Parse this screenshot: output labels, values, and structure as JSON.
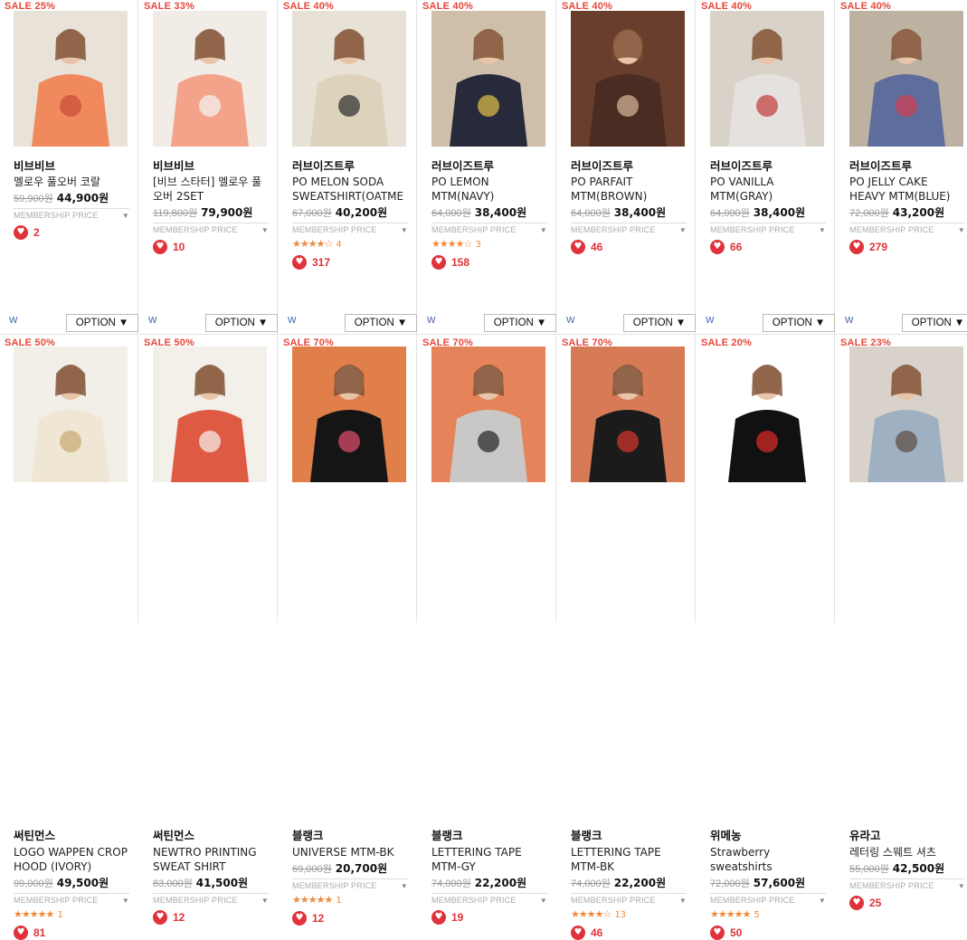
{
  "option_label": "OPTION",
  "option_arrow": "▼",
  "w_label": "W",
  "membership_label": "MEMBERSHIP PRICE",
  "heart_icon": "heart-icon",
  "colors": {
    "accent": "#e5483b",
    "heart": "#e0323a",
    "star": "#f08a3c"
  },
  "products": [
    {
      "badge": "SALE 25%",
      "brand": "비브비브",
      "name": "멜로우 풀오버 코랄",
      "orig": "59,900원",
      "sale": "44,900원",
      "rating": null,
      "review_count": null,
      "likes": "2"
    },
    {
      "badge": "SALE 33%",
      "brand": "비브비브",
      "name": "[비브 스타터] 멜로우 풀오버 2SET",
      "orig": "119,800원",
      "sale": "79,900원",
      "rating": null,
      "review_count": null,
      "likes": "10"
    },
    {
      "badge": "SALE 40%",
      "brand": "러브이즈트루",
      "name": "PO MELON SODA SWEATSHIRT(OATME",
      "orig": "67,000원",
      "sale": "40,200원",
      "rating": 4,
      "stars_text": "★★★★☆",
      "review_count": "4",
      "likes": "317"
    },
    {
      "badge": "SALE 40%",
      "brand": "러브이즈트루",
      "name": "PO LEMON MTM(NAVY)",
      "orig": "64,000원",
      "sale": "38,400원",
      "rating": 4.5,
      "stars_text": "★★★★☆",
      "review_count": "3",
      "likes": "158"
    },
    {
      "badge": "SALE 40%",
      "brand": "러브이즈트루",
      "name": "PO PARFAIT MTM(BROWN)",
      "orig": "64,000원",
      "sale": "38,400원",
      "rating": null,
      "review_count": null,
      "likes": "46"
    },
    {
      "badge": "SALE 40%",
      "brand": "러브이즈트루",
      "name": "PO VANILLA MTM(GRAY)",
      "orig": "64,000원",
      "sale": "38,400원",
      "rating": null,
      "review_count": null,
      "likes": "66"
    },
    {
      "badge": "SALE 40%",
      "brand": "러브이즈트루",
      "name": "PO JELLY CAKE HEAVY MTM(BLUE)",
      "orig": "72,000원",
      "sale": "43,200원",
      "rating": null,
      "review_count": null,
      "likes": "279"
    },
    {
      "badge": "SALE 50%",
      "brand": "써틴먼스",
      "name": "LOGO WAPPEN CROP HOOD (IVORY)",
      "orig": "99,000원",
      "sale": "49,500원",
      "rating": 5,
      "stars_text": "★★★★★",
      "review_count": "1",
      "likes": "81"
    },
    {
      "badge": "SALE 50%",
      "brand": "써틴먼스",
      "name": "NEWTRO PRINTING SWEAT SHIRT",
      "orig": "83,000원",
      "sale": "41,500원",
      "rating": null,
      "review_count": null,
      "likes": "12"
    },
    {
      "badge": "SALE 70%",
      "brand": "블랭크",
      "name": "UNIVERSE MTM-BK",
      "orig": "69,000원",
      "sale": "20,700원",
      "rating": 5,
      "stars_text": "★★★★★",
      "review_count": "1",
      "likes": "12"
    },
    {
      "badge": "SALE 70%",
      "brand": "블랭크",
      "name": "LETTERING TAPE MTM-GY",
      "orig": "74,000원",
      "sale": "22,200원",
      "rating": null,
      "review_count": null,
      "likes": "19"
    },
    {
      "badge": "SALE 70%",
      "brand": "블랭크",
      "name": "LETTERING TAPE MTM-BK",
      "orig": "74,000원",
      "sale": "22,200원",
      "rating": 4.5,
      "stars_text": "★★★★☆",
      "review_count": "13",
      "likes": "46"
    },
    {
      "badge": "SALE 20%",
      "brand": "위메농",
      "name": "Strawberry sweatshirts",
      "orig": "72,000원",
      "sale": "57,600원",
      "rating": 5,
      "stars_text": "★★★★★",
      "review_count": "5",
      "likes": "50"
    },
    {
      "badge": "SALE 23%",
      "brand": "유라고",
      "name": "레터링 스웨트 셔츠",
      "orig": "55,000원",
      "sale": "42,500원",
      "rating": null,
      "review_count": null,
      "likes": "25"
    }
  ]
}
